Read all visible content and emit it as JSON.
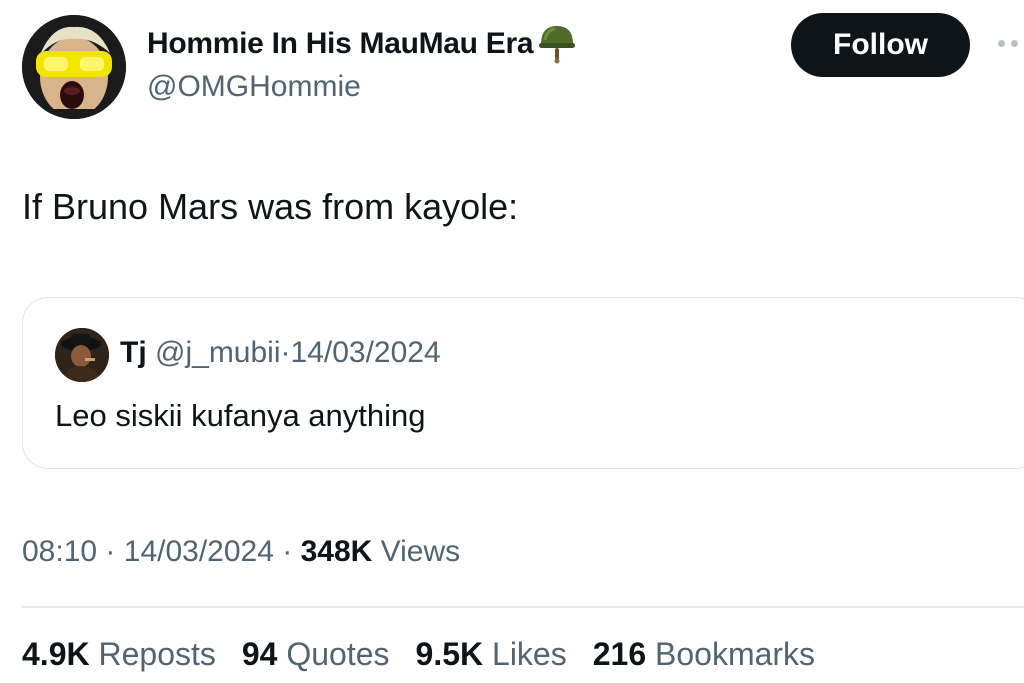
{
  "author": {
    "display_name": "Hommie In His MauMau Era",
    "handle": "@OMGHommie",
    "avatar_icon": "screaming-child-yellow-goggles-avatar",
    "badge_icon": "military-helmet-emoji"
  },
  "follow_label": "Follow",
  "tweet_text": "If Bruno Mars was from kayole:",
  "quote": {
    "name": "Tj",
    "handle": "@j_mubii",
    "separator": "·",
    "date": "14/03/2024",
    "text": "Leo siskii kufanya anything",
    "avatar_icon": "man-in-hat-avatar"
  },
  "meta": {
    "time": "08:10",
    "sep1": "·",
    "date": "14/03/2024",
    "sep2": "·",
    "views_count": "348K",
    "views_label": "Views"
  },
  "stats": [
    {
      "count": "4.9K",
      "label": "Reposts"
    },
    {
      "count": "94",
      "label": "Quotes"
    },
    {
      "count": "9.5K",
      "label": "Likes"
    },
    {
      "count": "216",
      "label": "Bookmarks"
    }
  ],
  "colors": {
    "text": "#0f1419",
    "secondary": "#536471",
    "button_bg": "#0f1419",
    "border": "#e1e6ea"
  }
}
